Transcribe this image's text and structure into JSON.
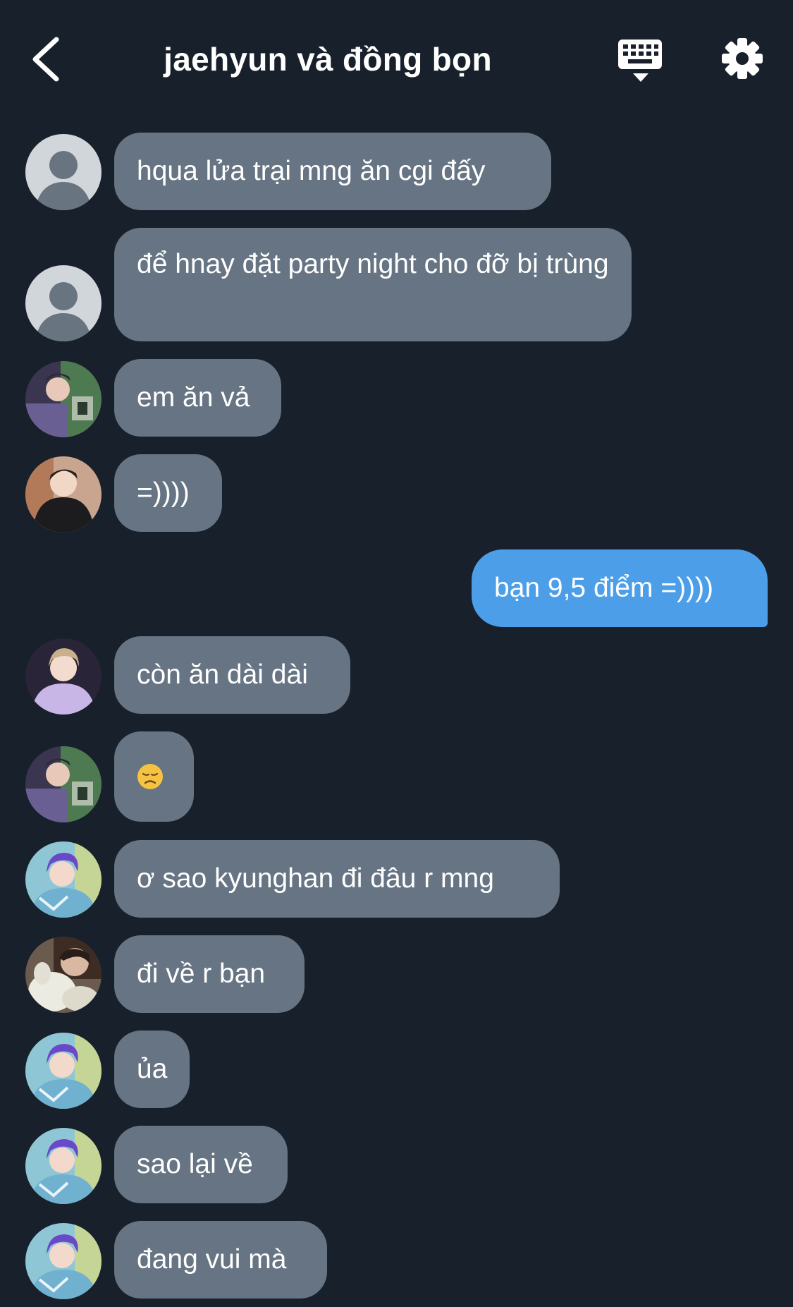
{
  "header": {
    "title": "jaehyun và đồng bọn",
    "back_icon": "chevron-left-icon",
    "keyboard_icon": "keyboard-icon",
    "settings_icon": "gear-icon"
  },
  "messages": [
    {
      "sender": "placeholder",
      "text": "hqua lửa trại mng ăn cgi đấy"
    },
    {
      "sender": "placeholder",
      "text": "để hnay đặt party night cho đỡ bị trùng"
    },
    {
      "sender": "member-green",
      "text": "em ăn vả"
    },
    {
      "sender": "member-black-hoodie",
      "text": "=))))"
    },
    {
      "sender": "me",
      "text": "bạn 9,5 điểm =))))"
    },
    {
      "sender": "member-lavender",
      "text": "còn ăn dài dài"
    },
    {
      "sender": "member-green",
      "text": "",
      "emoji": "disappointed-face-emoji"
    },
    {
      "sender": "member-purple-hair",
      "text": "ơ sao kyunghan đi đâu r mng"
    },
    {
      "sender": "member-plush",
      "text": "đi về r bạn"
    },
    {
      "sender": "member-purple-hair",
      "text": "ủa"
    },
    {
      "sender": "member-purple-hair",
      "text": "sao lại về"
    },
    {
      "sender": "member-purple-hair",
      "text": "đang vui mà"
    }
  ],
  "colors": {
    "background": "#17202b",
    "incoming_bubble": "#667483",
    "outgoing_bubble": "#4c9ee8",
    "text": "#ffffff"
  }
}
